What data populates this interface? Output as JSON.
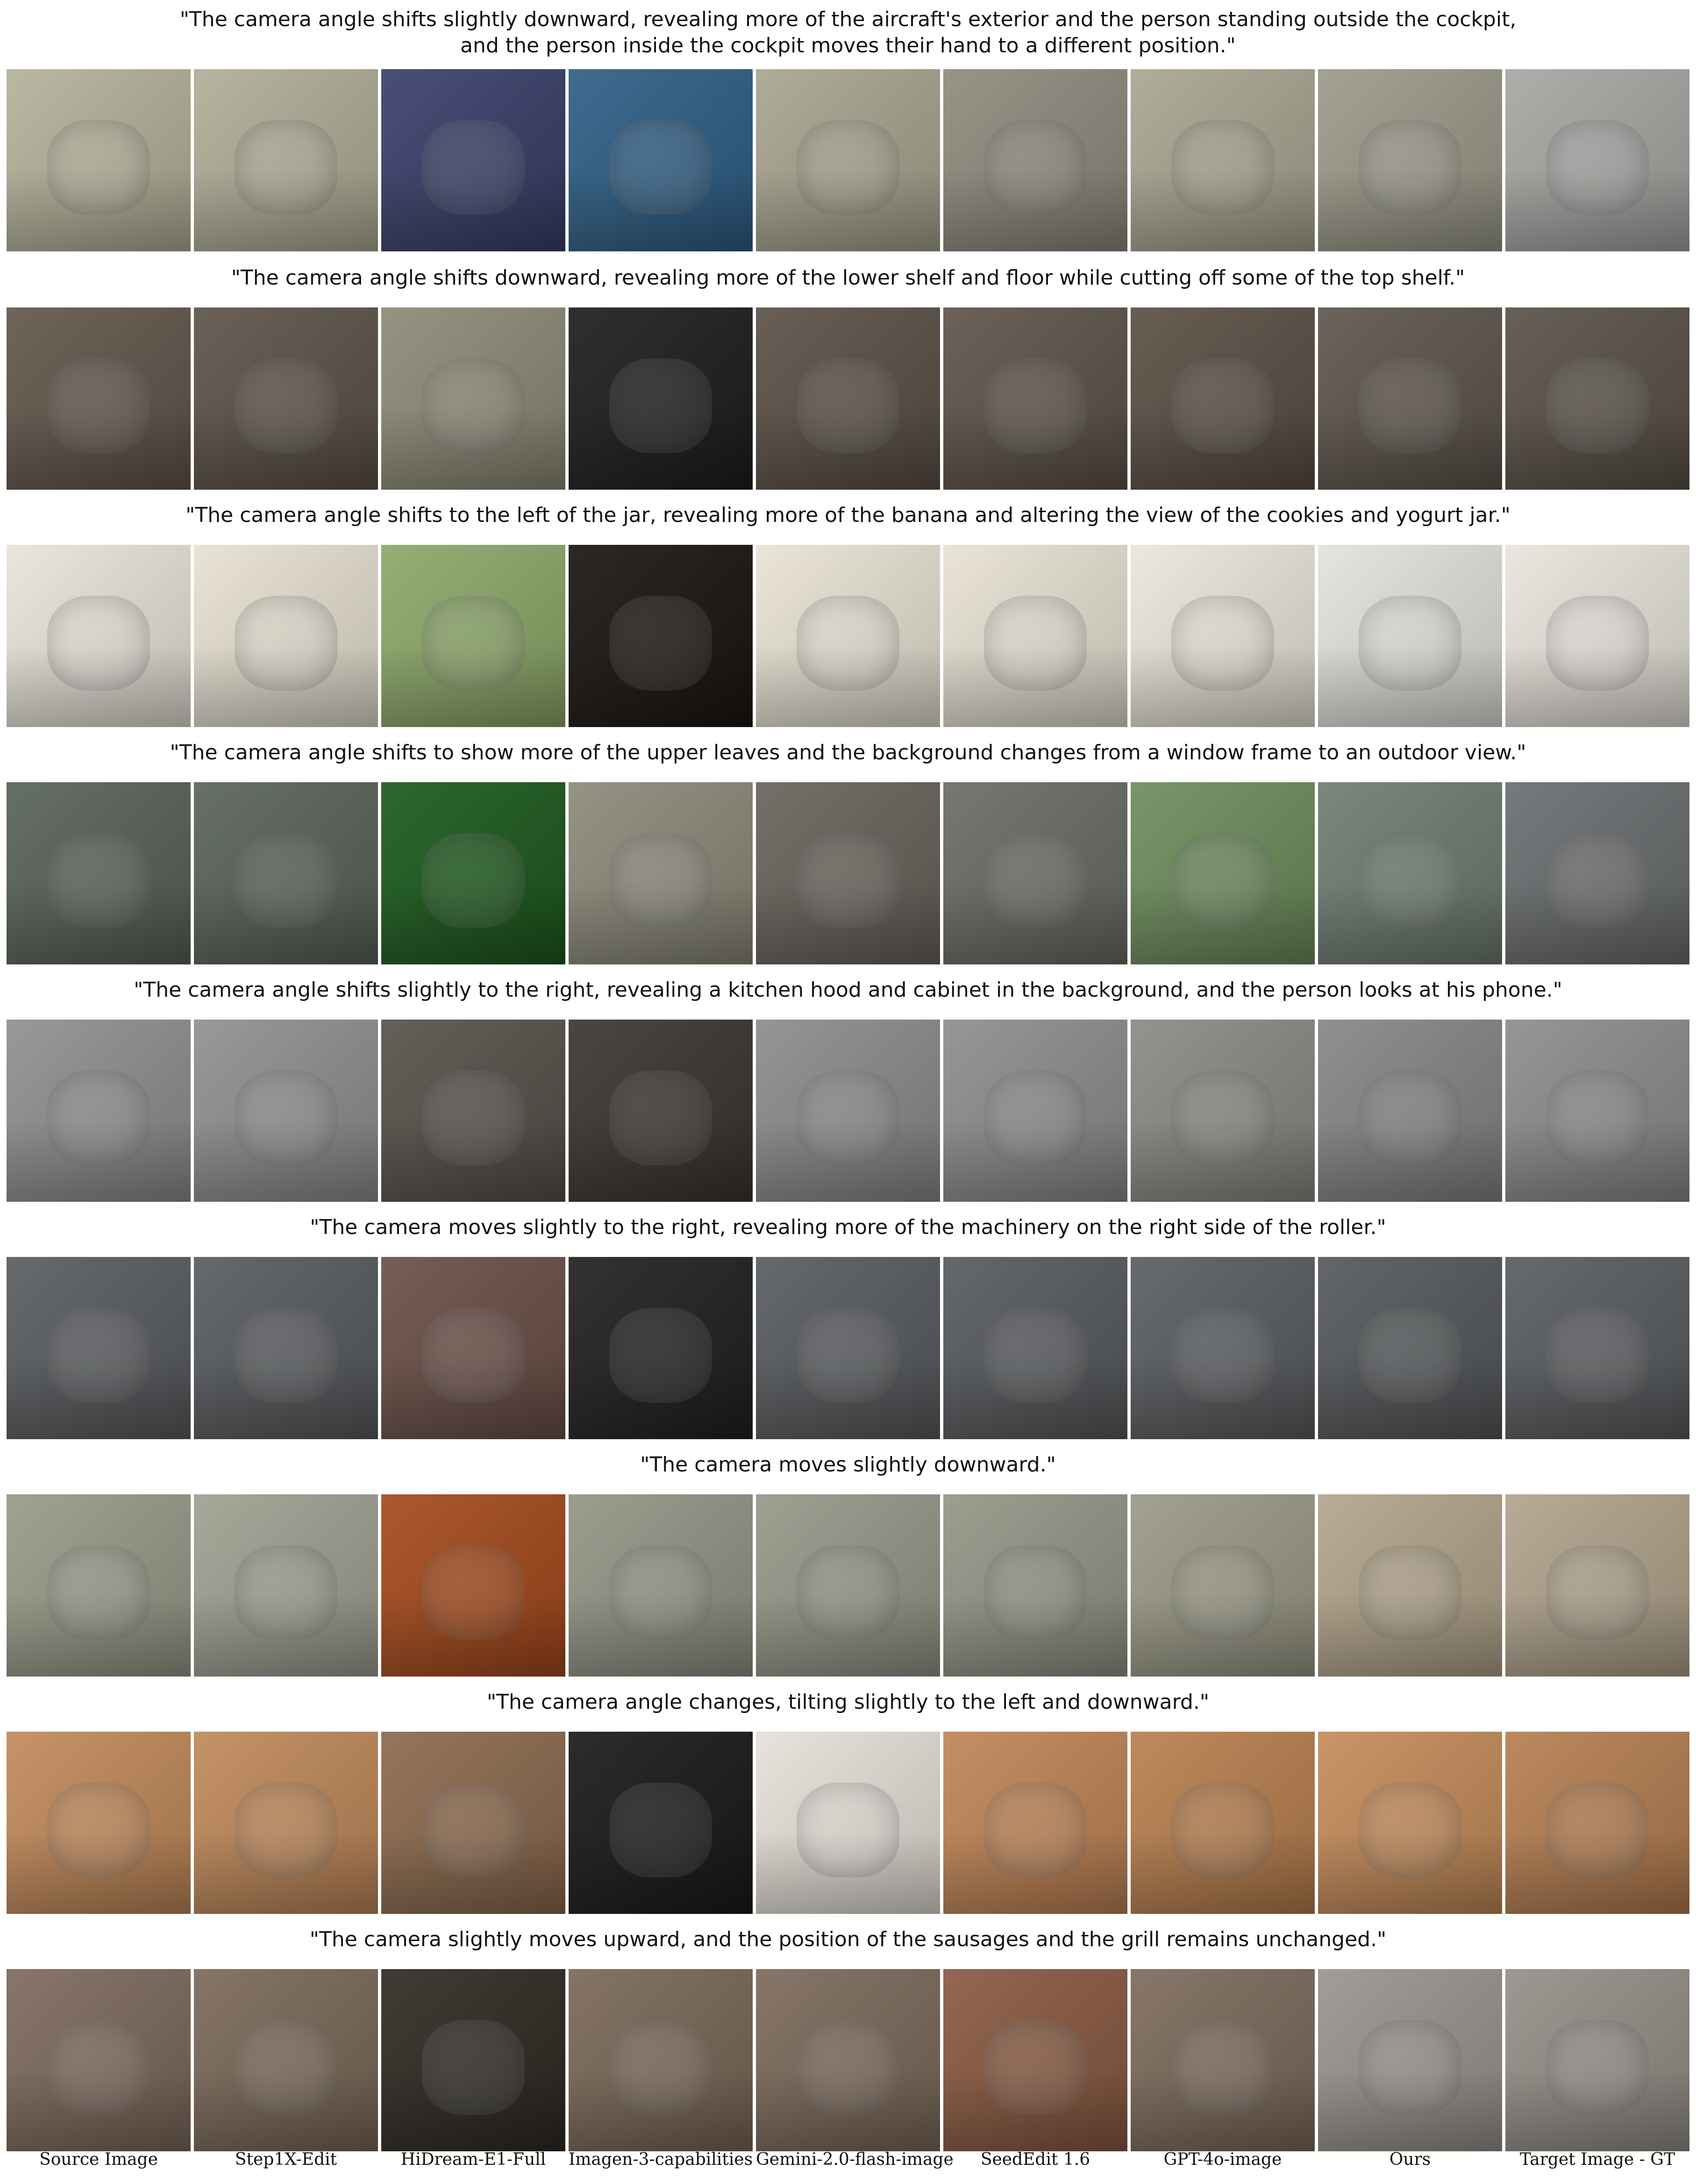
{
  "methods": [
    "Source Image",
    "Step1X-Edit",
    "HiDream-E1-Full",
    "Imagen-3-capabilities",
    "Gemini-2.0-flash-image",
    "SeedEdit 1.6",
    "GPT-4o-image",
    "Ours",
    "Target Image - GT"
  ],
  "rows": [
    {
      "caption": "\"The camera angle shifts slightly downward, revealing more of the aircraft's exterior and the person standing outside the cockpit,\nand the person inside the cockpit moves their hand to a different position.\"",
      "colors": [
        "#b5b29a",
        "#b1ae98",
        "#39406a",
        "#2f5f86",
        "#a8a590",
        "#8f8b7e",
        "#aaa692",
        "#9c9a8a",
        "#a7a8a4"
      ]
    },
    {
      "caption": "\"The camera angle shifts downward, revealing more of the lower shelf and floor while cutting off some of the top shelf.\"",
      "colors": [
        "#62574c",
        "#5d5349",
        "#8e8a78",
        "#1e1e1e",
        "#5b5147",
        "#5e544a",
        "#5a5045",
        "#5f564d",
        "#5b5249"
      ]
    },
    {
      "caption": "\"The camera angle shifts to the left of the jar, revealing more of the banana and altering the view of the cookies and yogurt jar.\"",
      "colors": [
        "#e8e4da",
        "#e7e1d2",
        "#8da86a",
        "#1a1612",
        "#e9e3d5",
        "#e8e2d4",
        "#ece6da",
        "#e3e3dd",
        "#e9e5dd"
      ]
    },
    {
      "caption": "\"The camera angle shifts to show more of the upper leaves and the background changes from a window frame to an outdoor view.\"",
      "colors": [
        "#596358",
        "#5a6459",
        "#1d5a1e",
        "#8c8a7a",
        "#6a635c",
        "#6a6d66",
        "#6d8d5d",
        "#6f7d73",
        "#6b6e70"
      ]
    },
    {
      "caption": "\"The camera angle shifts slightly to the right, revealing a kitchen hood and cabinet in the background, and the person looks at his phone.\"",
      "colors": [
        "#8e9091",
        "#8f9090",
        "#58514b",
        "#3b3630",
        "#8b8c8b",
        "#8d8e8e",
        "#8b8a86",
        "#868784",
        "#8c8d8d"
      ]
    },
    {
      "caption": "\"The camera moves slightly to the right, revealing more of the machinery on the right side of the roller.\"",
      "colors": [
        "#5a5d60",
        "#595c5f",
        "#6b5048",
        "#23211f",
        "#595c5f",
        "#585b5e",
        "#5b5e61",
        "#56595c",
        "#5a5d60"
      ]
    },
    {
      "caption": "\"The camera moves slightly downward.\"",
      "colors": [
        "#9a9a8a",
        "#a0a092",
        "#a54a1c",
        "#949486",
        "#979789",
        "#959587",
        "#9b9a88",
        "#b3a58c",
        "#b1a48d"
      ]
    },
    {
      "caption": "\"The camera angle changes, tilting slightly to the left and downward.\"",
      "colors": [
        "#c28a5b",
        "#c0895b",
        "#8c6a4e",
        "#1c1a18",
        "#e6e0d8",
        "#c08557",
        "#b9804f",
        "#c58c5a",
        "#b67f52"
      ]
    },
    {
      "caption": "\"The camera slightly moves upward, and the position of the sausages and the grill remains unchanged.\"",
      "colors": [
        "#7d6a5c",
        "#7b6959",
        "#2f2b24",
        "#7a6858",
        "#7c6a5b",
        "#8a5a42",
        "#7d6b5c",
        "#99948e",
        "#958f88"
      ]
    }
  ]
}
